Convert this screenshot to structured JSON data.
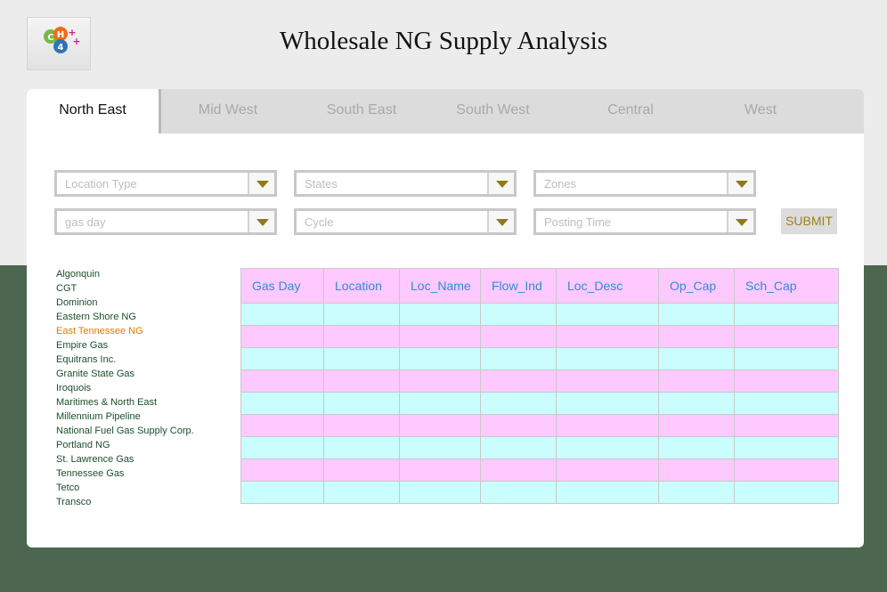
{
  "header": {
    "title": "Wholesale NG Supply Analysis",
    "logo": {
      "letters": [
        "C",
        "H",
        "4"
      ],
      "plus_marks": [
        "+",
        "+"
      ]
    }
  },
  "tabs": [
    {
      "label": "North East",
      "active": true
    },
    {
      "label": "Mid West",
      "active": false
    },
    {
      "label": "South East",
      "active": false
    },
    {
      "label": "South West",
      "active": false
    },
    {
      "label": "Central",
      "active": false
    },
    {
      "label": "West",
      "active": false
    }
  ],
  "filters": {
    "location_type": "Location Type",
    "states": "States",
    "zones": "Zones",
    "gas_day": "gas day",
    "cycle": "Cycle",
    "posting_time": "Posting Time"
  },
  "submit_label": "SUBMIT",
  "pipelines": [
    "Algonquin",
    "CGT",
    "Dominion",
    "Eastern Shore NG",
    "East Tennessee NG",
    "Empire Gas",
    "Equitrans Inc.",
    "Granite State Gas",
    "Iroquois",
    "Maritimes & North East",
    "Millennium Pipeline",
    "National Fuel Gas Supply Corp.",
    "Portland NG",
    "St. Lawrence Gas",
    "Tennessee Gas",
    "Tetco",
    "Transco"
  ],
  "selected_pipeline": "East Tennessee NG",
  "table": {
    "columns": [
      "Gas Day",
      "Location",
      "Loc_Name",
      "Flow_Ind",
      "Loc_Desc",
      "Op_Cap",
      "Sch_Cap"
    ],
    "rows": [
      [
        "",
        "",
        "",
        "",
        "",
        "",
        ""
      ],
      [
        "",
        "",
        "",
        "",
        "",
        "",
        ""
      ],
      [
        "",
        "",
        "",
        "",
        "",
        "",
        ""
      ],
      [
        "",
        "",
        "",
        "",
        "",
        "",
        ""
      ],
      [
        "",
        "",
        "",
        "",
        "",
        "",
        ""
      ],
      [
        "",
        "",
        "",
        "",
        "",
        "",
        ""
      ],
      [
        "",
        "",
        "",
        "",
        "",
        "",
        ""
      ],
      [
        "",
        "",
        "",
        "",
        "",
        "",
        ""
      ],
      [
        "",
        "",
        "",
        "",
        "",
        "",
        ""
      ]
    ]
  },
  "colors": {
    "background_top": "#ececec",
    "background_bottom": "#4d6650",
    "header_row": "#fec9fe",
    "row_cyan": "#c9fdfe",
    "row_magenta": "#fec9fe",
    "header_text": "#2b8ed6",
    "selected_pipeline": "#e07b00",
    "dropdown_arrow": "#8f7b12"
  },
  "icons": {
    "dropdown": "triangle-down-icon",
    "logo": "ch4-logo"
  }
}
